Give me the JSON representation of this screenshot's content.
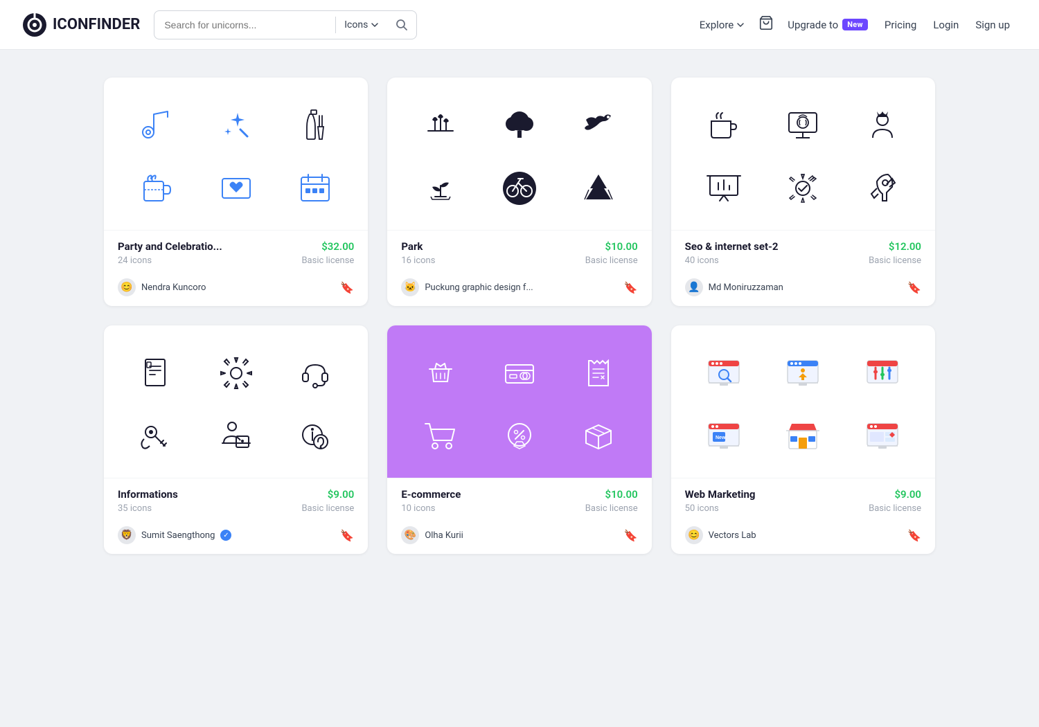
{
  "header": {
    "logo_text": "ICONFINDER",
    "search_placeholder": "Search for unicorns...",
    "search_type": "Icons",
    "nav": {
      "explore": "Explore",
      "upgrade_prefix": "Upgrade to",
      "new_badge": "New",
      "pricing": "Pricing",
      "login": "Login",
      "signup": "Sign up"
    }
  },
  "cards": [
    {
      "id": "party",
      "title": "Party and Celebratio...",
      "count": "24 icons",
      "price": "$32.00",
      "license": "Basic license",
      "author": "Nendra Kuncoro",
      "bg": "white",
      "style": "outline-blue"
    },
    {
      "id": "park",
      "title": "Park",
      "count": "16 icons",
      "price": "$10.00",
      "license": "Basic license",
      "author": "Puckung graphic design f...",
      "bg": "white",
      "style": "solid-black"
    },
    {
      "id": "seo",
      "title": "Seo & internet set-2",
      "count": "40 icons",
      "price": "$12.00",
      "license": "Basic license",
      "author": "Md Moniruzzaman",
      "bg": "white",
      "style": "outline-black"
    },
    {
      "id": "info",
      "title": "Informations",
      "count": "35 icons",
      "price": "$9.00",
      "license": "Basic license",
      "author": "Sumit Saengthong",
      "bg": "white",
      "style": "outline-black",
      "verified": true
    },
    {
      "id": "ecommerce",
      "title": "E-commerce",
      "count": "10 icons",
      "price": "$10.00",
      "license": "Basic license",
      "author": "Olha Kurii",
      "bg": "purple",
      "style": "outline-white"
    },
    {
      "id": "webmarketing",
      "title": "Web Marketing",
      "count": "50 icons",
      "price": "$9.00",
      "license": "Basic license",
      "author": "Vectors Lab",
      "bg": "white",
      "style": "color"
    }
  ]
}
